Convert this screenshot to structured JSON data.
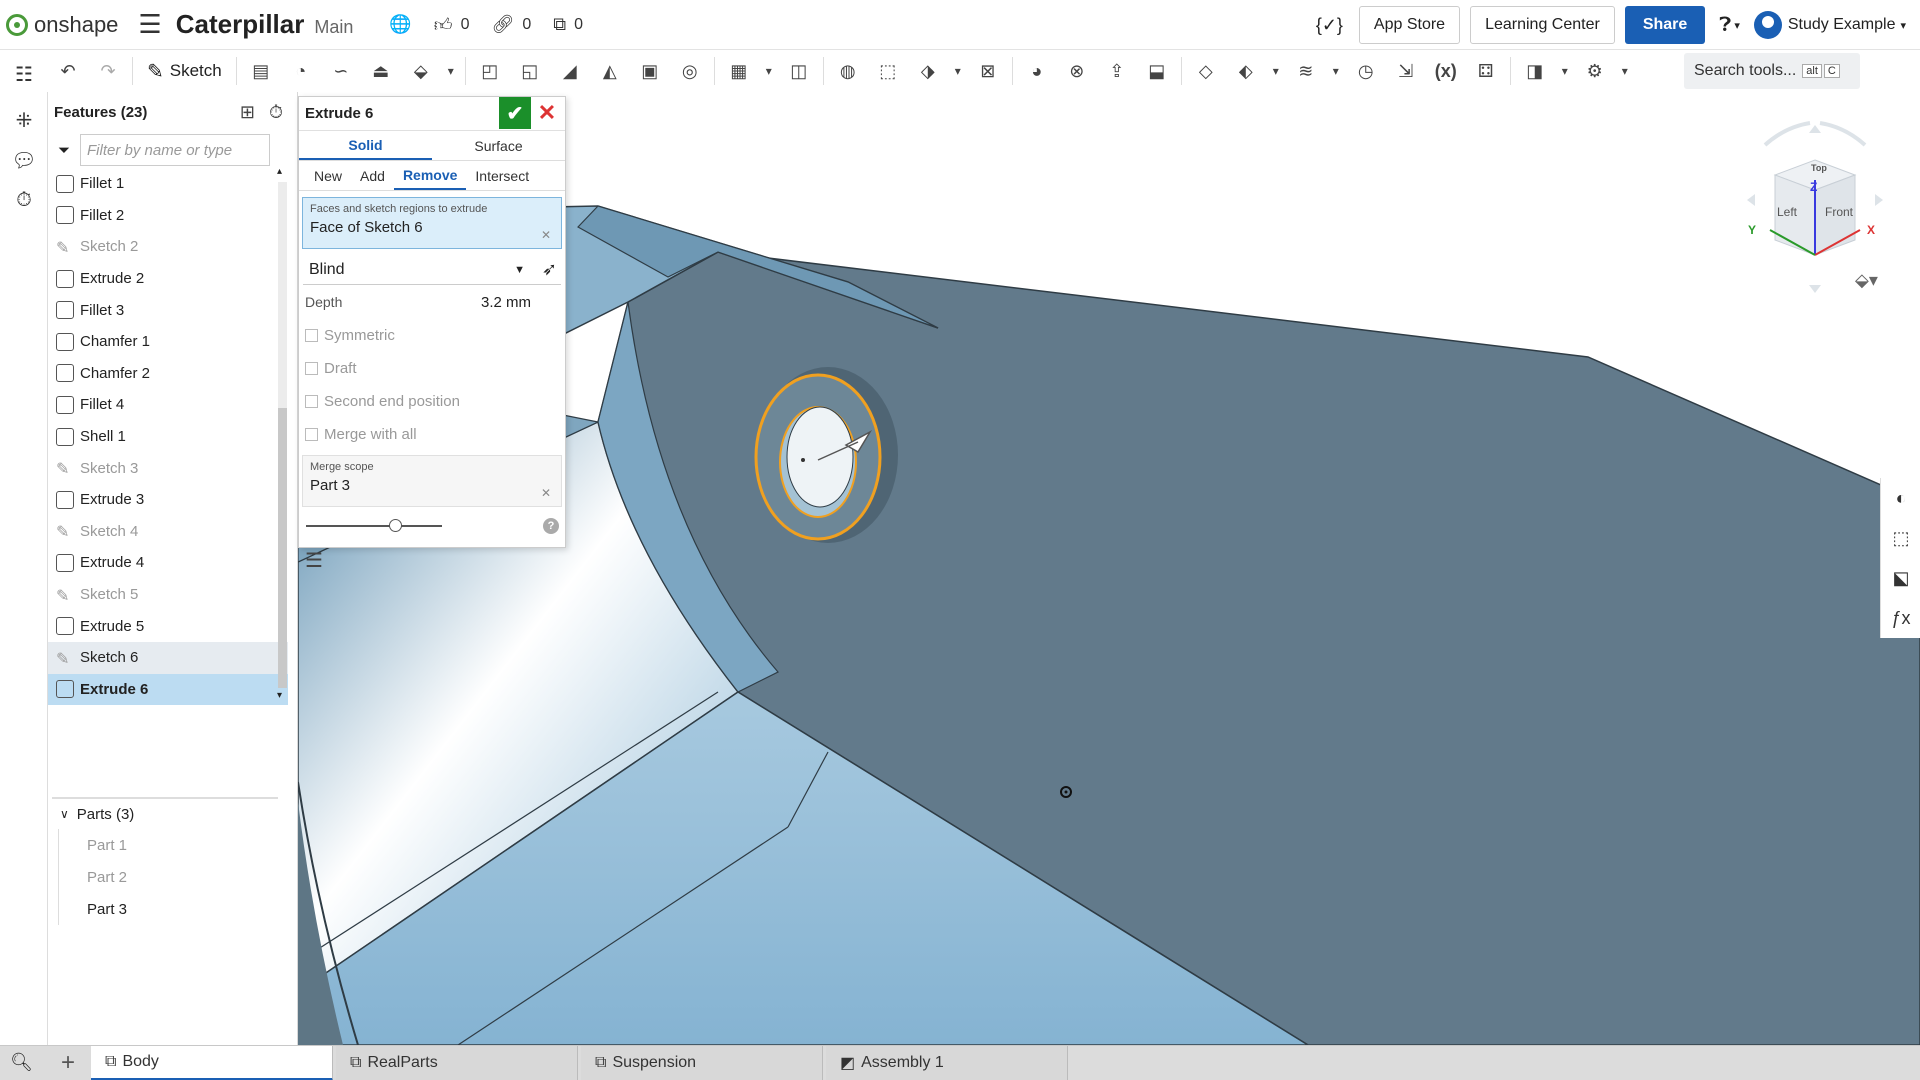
{
  "app": {
    "brand": "onshape",
    "document_title": "Caterpillar",
    "branch": "Main"
  },
  "topbar": {
    "likes": "0",
    "links": "0",
    "copies": "0",
    "app_store": "App Store",
    "learning_center": "Learning Center",
    "share": "Share",
    "user": "Study Example",
    "variable_icon": "{✓}"
  },
  "toolbar": {
    "sketch_label": "Sketch",
    "search_placeholder": "Search tools...",
    "search_kbd1": "alt",
    "search_kbd2": "C"
  },
  "features": {
    "title": "Features (23)",
    "filter_placeholder": "Filter by name or type",
    "items": [
      {
        "label": "Fillet 1",
        "type": "feature"
      },
      {
        "label": "Fillet 2",
        "type": "feature"
      },
      {
        "label": "Sketch 2",
        "type": "sketch"
      },
      {
        "label": "Extrude 2",
        "type": "feature"
      },
      {
        "label": "Fillet 3",
        "type": "feature"
      },
      {
        "label": "Chamfer 1",
        "type": "feature"
      },
      {
        "label": "Chamfer 2",
        "type": "feature"
      },
      {
        "label": "Fillet 4",
        "type": "feature"
      },
      {
        "label": "Shell 1",
        "type": "feature"
      },
      {
        "label": "Sketch 3",
        "type": "sketch"
      },
      {
        "label": "Extrude 3",
        "type": "feature"
      },
      {
        "label": "Sketch 4",
        "type": "sketch"
      },
      {
        "label": "Extrude 4",
        "type": "feature"
      },
      {
        "label": "Sketch 5",
        "type": "sketch"
      },
      {
        "label": "Extrude 5",
        "type": "feature"
      },
      {
        "label": "Sketch 6",
        "type": "sketch-hover"
      },
      {
        "label": "Extrude 6",
        "type": "selected"
      }
    ],
    "parts_title": "Parts (3)",
    "parts": [
      "Part 1",
      "Part 2",
      "Part 3"
    ]
  },
  "dialog": {
    "title": "Extrude 6",
    "tab_solid": "Solid",
    "tab_surface": "Surface",
    "op_new": "New",
    "op_add": "Add",
    "op_remove": "Remove",
    "op_intersect": "Intersect",
    "faces_label": "Faces and sketch regions to extrude",
    "faces_value": "Face of Sketch 6",
    "end_type": "Blind",
    "depth_label": "Depth",
    "depth_value": "3.2 mm",
    "symmetric": "Symmetric",
    "draft": "Draft",
    "second_end": "Second end position",
    "merge_all": "Merge with all",
    "merge_scope_label": "Merge scope",
    "merge_scope_value": "Part 3"
  },
  "viewcube": {
    "top": "Top",
    "left": "Left",
    "front": "Front",
    "axis_x": "X",
    "axis_y": "Y",
    "axis_z": "Z"
  },
  "bottom_tabs": [
    "Body",
    "RealParts",
    "Suspension",
    "Assembly 1"
  ],
  "colors": {
    "accent": "#1a5fb4",
    "ok": "#1b8f2a",
    "model_dark": "#5f7585",
    "model_light": "#9fc4db",
    "highlight": "#f0a020"
  }
}
